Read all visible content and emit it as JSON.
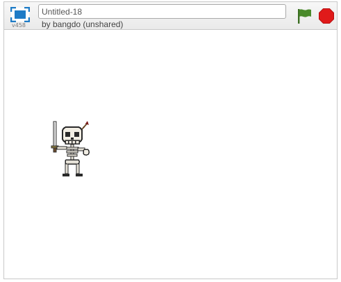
{
  "player": {
    "version": "v458",
    "title_value": "Untitled-18",
    "author_line": "by bangdo (unshared)",
    "icons": {
      "fullscreen": "fullscreen-icon",
      "green_flag": "green-flag-icon",
      "stop": "stop-sign-icon"
    },
    "colors": {
      "fullscreen_blue": "#1e7bc6",
      "flag_green": "#4a8a2b",
      "stop_red": "#e01a1a"
    }
  },
  "stage": {
    "sprite": "skeleton-knight-sprite"
  }
}
